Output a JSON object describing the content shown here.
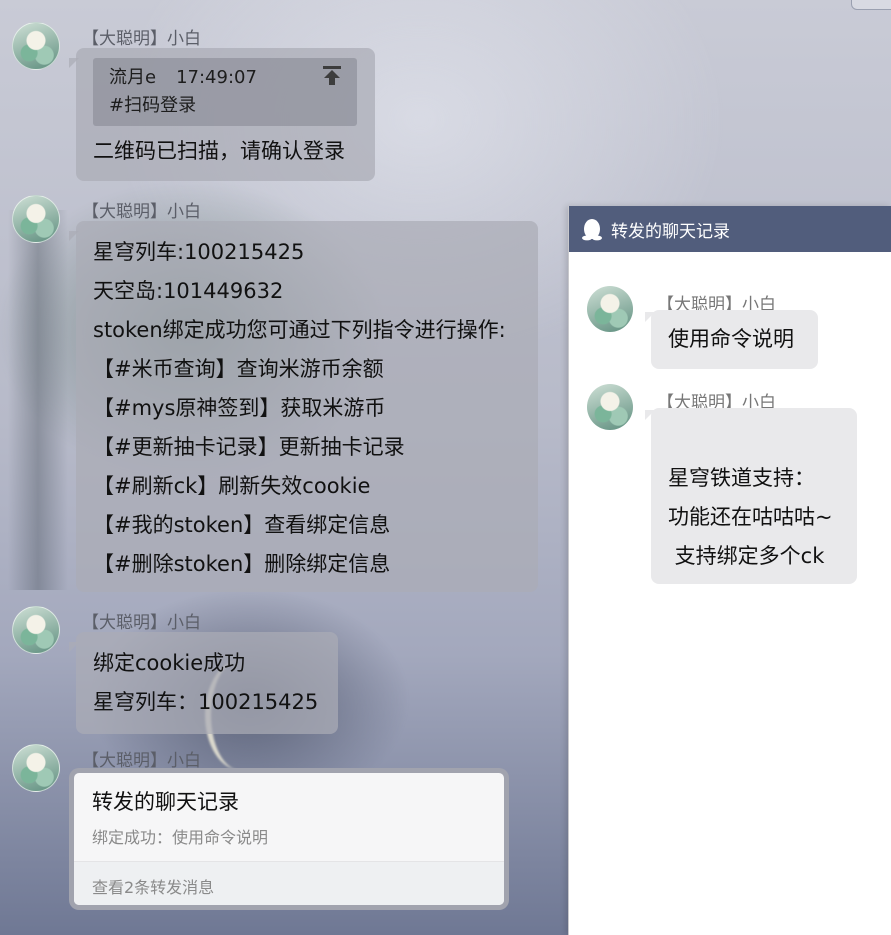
{
  "messages": [
    {
      "sender": "【大聪明】小白",
      "quote": {
        "name": "流月e",
        "time": "17:49:07",
        "text": "#扫码登录"
      },
      "lines": [
        "二维码已扫描，请确认登录"
      ]
    },
    {
      "sender": "【大聪明】小白",
      "lines": [
        "星穹列车:100215425",
        "天空岛:101449632",
        "stoken绑定成功您可通过下列指令进行操作:",
        "【#米币查询】查询米游币余额",
        "【#mys原神签到】获取米游币",
        "【#更新抽卡记录】更新抽卡记录",
        "【#刷新ck】刷新失效cookie",
        "【#我的stoken】查看绑定信息",
        "【#删除stoken】删除绑定信息"
      ]
    },
    {
      "sender": "【大聪明】小白",
      "lines": [
        "绑定cookie成功",
        "星穹列车：100215425"
      ]
    },
    {
      "sender": "【大聪明】小白",
      "forward": {
        "title": "转发的聊天记录",
        "preview": "绑定成功：使用命令说明",
        "footer": "查看2条转发消息"
      }
    }
  ],
  "panel": {
    "title": "转发的聊天记录",
    "messages": [
      {
        "sender": "【大聪明】小白",
        "lines": [
          "使用命令说明"
        ]
      },
      {
        "sender": "【大聪明】小白",
        "lines": [
          "",
          "星穹铁道支持：",
          "功能还在咕咕咕~",
          " 支持绑定多个ck"
        ]
      }
    ]
  },
  "icons": {
    "quote_jump": "arrow-up-to-line-icon",
    "panel_logo": "penguin-icon"
  },
  "colors": {
    "panel_header": "#515d7c",
    "bubble": "#e9e9eb"
  }
}
